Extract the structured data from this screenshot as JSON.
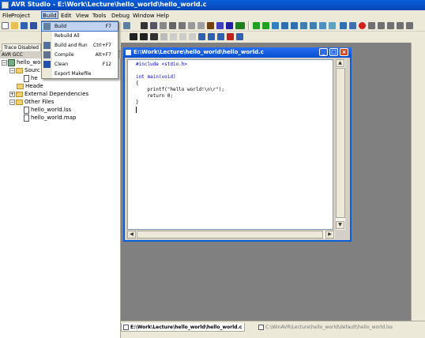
{
  "app": {
    "title": "AVR Studio - E:\\Work\\Lecture\\hello_world\\hello_world.c"
  },
  "menu": {
    "items": [
      "File",
      "Project",
      "Build",
      "Edit",
      "View",
      "Tools",
      "Debug",
      "Window",
      "Help"
    ]
  },
  "build_menu": {
    "items": [
      {
        "label": "Build",
        "shortcut": "F7",
        "icon": "build-icon"
      },
      {
        "label": "Rebuild All",
        "shortcut": "",
        "icon": ""
      },
      {
        "label": "Build and Run",
        "shortcut": "Ctrl+F7",
        "icon": "build-run-icon"
      },
      {
        "label": "Compile",
        "shortcut": "Alt+F7",
        "icon": "compile-icon"
      },
      {
        "label": "Clean",
        "shortcut": "F12",
        "icon": "clean-icon"
      },
      {
        "label": "Export Makefile",
        "shortcut": "",
        "icon": ""
      }
    ]
  },
  "left_panel": {
    "tab_label": "Trace Disabled",
    "header": "AVR GCC",
    "tree": [
      {
        "label": "hello_wo",
        "level": 0
      },
      {
        "label": "Sourc",
        "level": 1
      },
      {
        "label": "he",
        "level": 2
      },
      {
        "label": "Heade",
        "level": 1
      },
      {
        "label": "External Dependencies",
        "level": 1
      },
      {
        "label": "Other Files",
        "level": 1
      },
      {
        "label": "hello_world.lss",
        "level": 2
      },
      {
        "label": "hello_world.map",
        "level": 2
      }
    ]
  },
  "editor": {
    "title": "E:\\Work\\Lecture\\hello_world\\hello_world.c",
    "code": [
      {
        "text": "#include <stdio.h>",
        "kw": false
      },
      {
        "text": "",
        "kw": false
      },
      {
        "text": "int main(void)",
        "kw": true
      },
      {
        "text": "{",
        "kw": false
      },
      {
        "text": "    printf(\"hello world!\\n\\r\");",
        "kw": false
      },
      {
        "text": "    return 0;",
        "kw": false
      },
      {
        "text": "}",
        "kw": false
      }
    ]
  },
  "bottom_tabs": [
    {
      "label": "E:\\Work\\Lecture\\hello_world\\hello_world.c",
      "active": true
    },
    {
      "label": "C:\\WinAVR\\Lecture\\hello_world\\default\\hello_world.lss",
      "active": false
    }
  ]
}
